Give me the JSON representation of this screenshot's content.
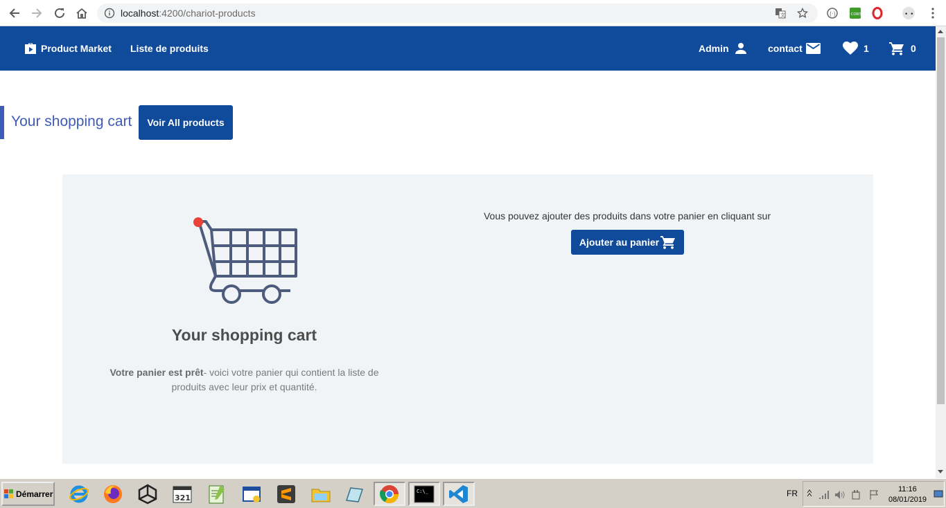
{
  "browser": {
    "url_host": "localhost",
    "url_path": ":4200/chariot-products"
  },
  "header": {
    "brand": "Product Market",
    "nav_products": "Liste de produits",
    "admin": "Admin",
    "contact": "contact",
    "wishlist_count": "1",
    "cart_count": "0",
    "brand_color": "#0f4a9b"
  },
  "page": {
    "title": "Your shopping cart",
    "all_products_button": "Voir All products"
  },
  "panel": {
    "heading": "Your shopping cart",
    "description_bold": "Votre panier est prêt",
    "description_rest": "- voici votre panier qui contient la liste de produits avec leur prix et quantité.",
    "hint": "Vous pouvez ajouter des produits dans votre panier en cliquant sur",
    "add_button": "Ajouter au panier"
  },
  "taskbar": {
    "start": "Démarrer",
    "lang": "FR",
    "time": "11:16",
    "date": "08/01/2019"
  },
  "icons": [
    "back-icon",
    "forward-icon",
    "reload-icon",
    "home-icon",
    "info-icon",
    "translate-icon",
    "star-icon",
    "shopping-bag-icon",
    "person-icon",
    "mail-icon",
    "heart-icon",
    "cart-icon"
  ]
}
